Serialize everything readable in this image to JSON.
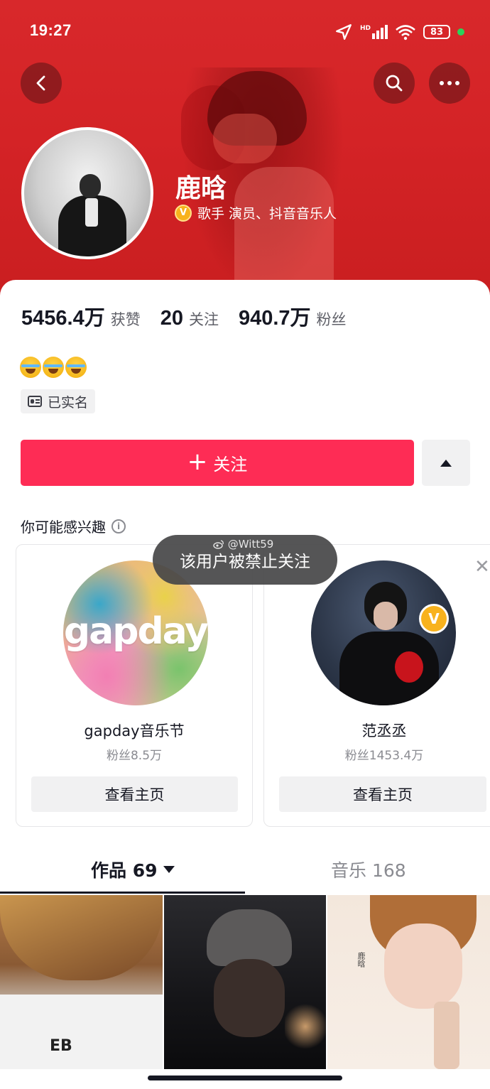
{
  "status_bar": {
    "time": "19:27",
    "battery": "83",
    "network": "HD"
  },
  "profile": {
    "name": "鹿晗",
    "verification": "歌手 演员、抖音音乐人",
    "stats": [
      {
        "value": "5456.4万",
        "label": "获赞"
      },
      {
        "value": "20",
        "label": "关注"
      },
      {
        "value": "940.7万",
        "label": "粉丝"
      }
    ],
    "bio": "😂😂😂",
    "realname_badge": "已实名",
    "follow_button": "关注"
  },
  "recommend": {
    "title": "你可能感兴趣",
    "cards": [
      {
        "name": "gapday音乐节",
        "fans": "粉丝8.5万",
        "button": "查看主页",
        "logo_text": "gapday"
      },
      {
        "name": "范丞丞",
        "fans": "粉丝1453.4万",
        "button": "查看主页"
      }
    ]
  },
  "toast": {
    "text": "该用户被禁止关注",
    "watermark": "@Witt59"
  },
  "tabs": [
    {
      "label": "作品 69",
      "active": true
    },
    {
      "label": "音乐 168",
      "active": false
    }
  ],
  "thumb_text": {
    "hoodie": "EB",
    "poster": "鹿晗"
  },
  "colors": {
    "accent": "#fe2c55",
    "cover": "#d42326",
    "verify": "#f8b21d"
  }
}
